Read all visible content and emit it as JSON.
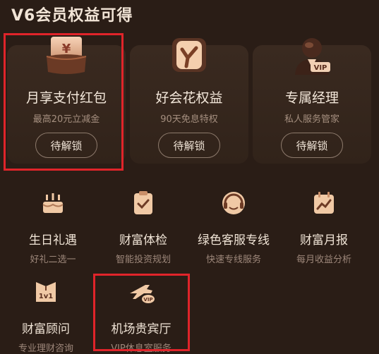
{
  "header": {
    "title": "V6会员权益可得"
  },
  "cards": [
    {
      "title": "月享支付红包",
      "subtitle": "最高20元立减金",
      "button": "待解锁",
      "icon": "red-envelope-icon"
    },
    {
      "title": "好会花权益",
      "subtitle": "90天免息特权",
      "button": "待解锁",
      "icon": "haohuihua-icon"
    },
    {
      "title": "专属经理",
      "subtitle": "私人服务管家",
      "button": "待解锁",
      "icon": "vip-manager-icon"
    }
  ],
  "items": [
    {
      "title": "生日礼遇",
      "subtitle": "好礼二选一",
      "icon": "birthday-cake-icon"
    },
    {
      "title": "财富体检",
      "subtitle": "智能投资规划",
      "icon": "clipboard-check-icon"
    },
    {
      "title": "绿色客服专线",
      "subtitle": "快速专线服务",
      "icon": "headset-icon"
    },
    {
      "title": "财富月报",
      "subtitle": "每月收益分析",
      "icon": "calendar-chart-icon"
    },
    {
      "title": "财富顾问",
      "subtitle": "专业理财咨询",
      "icon": "advisor-1v1-icon",
      "icon_text": "1v1"
    },
    {
      "title": "机场贵宾厅",
      "subtitle": "VIP休息室服务",
      "icon": "airplane-vip-icon",
      "icon_text": "VIP"
    }
  ],
  "colors": {
    "highlight": "#e0242a",
    "icon_accent": "#f0c9a5",
    "card_bg": "#3a2a20",
    "page_bg": "#2a1d16"
  },
  "currency_symbol": "¥",
  "badge_vip": "VIP"
}
